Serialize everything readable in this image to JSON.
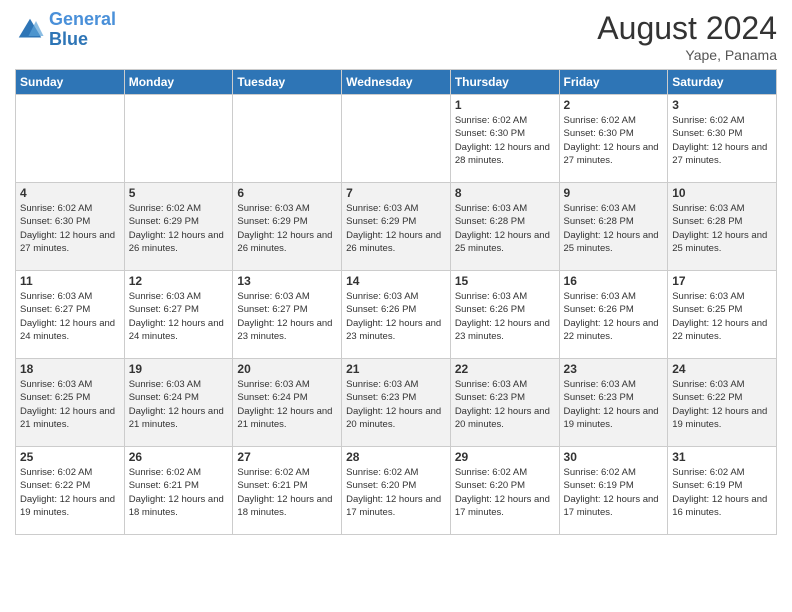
{
  "header": {
    "logo_line1": "General",
    "logo_line2": "Blue",
    "month_title": "August 2024",
    "location": "Yape, Panama"
  },
  "days_of_week": [
    "Sunday",
    "Monday",
    "Tuesday",
    "Wednesday",
    "Thursday",
    "Friday",
    "Saturday"
  ],
  "weeks": [
    [
      {
        "day": "",
        "info": ""
      },
      {
        "day": "",
        "info": ""
      },
      {
        "day": "",
        "info": ""
      },
      {
        "day": "",
        "info": ""
      },
      {
        "day": "1",
        "sunrise": "6:02 AM",
        "sunset": "6:30 PM",
        "daylight": "12 hours and 28 minutes."
      },
      {
        "day": "2",
        "sunrise": "6:02 AM",
        "sunset": "6:30 PM",
        "daylight": "12 hours and 27 minutes."
      },
      {
        "day": "3",
        "sunrise": "6:02 AM",
        "sunset": "6:30 PM",
        "daylight": "12 hours and 27 minutes."
      }
    ],
    [
      {
        "day": "4",
        "sunrise": "6:02 AM",
        "sunset": "6:30 PM",
        "daylight": "12 hours and 27 minutes."
      },
      {
        "day": "5",
        "sunrise": "6:02 AM",
        "sunset": "6:29 PM",
        "daylight": "12 hours and 26 minutes."
      },
      {
        "day": "6",
        "sunrise": "6:03 AM",
        "sunset": "6:29 PM",
        "daylight": "12 hours and 26 minutes."
      },
      {
        "day": "7",
        "sunrise": "6:03 AM",
        "sunset": "6:29 PM",
        "daylight": "12 hours and 26 minutes."
      },
      {
        "day": "8",
        "sunrise": "6:03 AM",
        "sunset": "6:28 PM",
        "daylight": "12 hours and 25 minutes."
      },
      {
        "day": "9",
        "sunrise": "6:03 AM",
        "sunset": "6:28 PM",
        "daylight": "12 hours and 25 minutes."
      },
      {
        "day": "10",
        "sunrise": "6:03 AM",
        "sunset": "6:28 PM",
        "daylight": "12 hours and 25 minutes."
      }
    ],
    [
      {
        "day": "11",
        "sunrise": "6:03 AM",
        "sunset": "6:27 PM",
        "daylight": "12 hours and 24 minutes."
      },
      {
        "day": "12",
        "sunrise": "6:03 AM",
        "sunset": "6:27 PM",
        "daylight": "12 hours and 24 minutes."
      },
      {
        "day": "13",
        "sunrise": "6:03 AM",
        "sunset": "6:27 PM",
        "daylight": "12 hours and 23 minutes."
      },
      {
        "day": "14",
        "sunrise": "6:03 AM",
        "sunset": "6:26 PM",
        "daylight": "12 hours and 23 minutes."
      },
      {
        "day": "15",
        "sunrise": "6:03 AM",
        "sunset": "6:26 PM",
        "daylight": "12 hours and 23 minutes."
      },
      {
        "day": "16",
        "sunrise": "6:03 AM",
        "sunset": "6:26 PM",
        "daylight": "12 hours and 22 minutes."
      },
      {
        "day": "17",
        "sunrise": "6:03 AM",
        "sunset": "6:25 PM",
        "daylight": "12 hours and 22 minutes."
      }
    ],
    [
      {
        "day": "18",
        "sunrise": "6:03 AM",
        "sunset": "6:25 PM",
        "daylight": "12 hours and 21 minutes."
      },
      {
        "day": "19",
        "sunrise": "6:03 AM",
        "sunset": "6:24 PM",
        "daylight": "12 hours and 21 minutes."
      },
      {
        "day": "20",
        "sunrise": "6:03 AM",
        "sunset": "6:24 PM",
        "daylight": "12 hours and 21 minutes."
      },
      {
        "day": "21",
        "sunrise": "6:03 AM",
        "sunset": "6:23 PM",
        "daylight": "12 hours and 20 minutes."
      },
      {
        "day": "22",
        "sunrise": "6:03 AM",
        "sunset": "6:23 PM",
        "daylight": "12 hours and 20 minutes."
      },
      {
        "day": "23",
        "sunrise": "6:03 AM",
        "sunset": "6:23 PM",
        "daylight": "12 hours and 19 minutes."
      },
      {
        "day": "24",
        "sunrise": "6:03 AM",
        "sunset": "6:22 PM",
        "daylight": "12 hours and 19 minutes."
      }
    ],
    [
      {
        "day": "25",
        "sunrise": "6:02 AM",
        "sunset": "6:22 PM",
        "daylight": "12 hours and 19 minutes."
      },
      {
        "day": "26",
        "sunrise": "6:02 AM",
        "sunset": "6:21 PM",
        "daylight": "12 hours and 18 minutes."
      },
      {
        "day": "27",
        "sunrise": "6:02 AM",
        "sunset": "6:21 PM",
        "daylight": "12 hours and 18 minutes."
      },
      {
        "day": "28",
        "sunrise": "6:02 AM",
        "sunset": "6:20 PM",
        "daylight": "12 hours and 17 minutes."
      },
      {
        "day": "29",
        "sunrise": "6:02 AM",
        "sunset": "6:20 PM",
        "daylight": "12 hours and 17 minutes."
      },
      {
        "day": "30",
        "sunrise": "6:02 AM",
        "sunset": "6:19 PM",
        "daylight": "12 hours and 17 minutes."
      },
      {
        "day": "31",
        "sunrise": "6:02 AM",
        "sunset": "6:19 PM",
        "daylight": "12 hours and 16 minutes."
      }
    ]
  ],
  "labels": {
    "sunrise_prefix": "Sunrise: ",
    "sunset_prefix": "Sunset: ",
    "daylight_prefix": "Daylight: "
  }
}
